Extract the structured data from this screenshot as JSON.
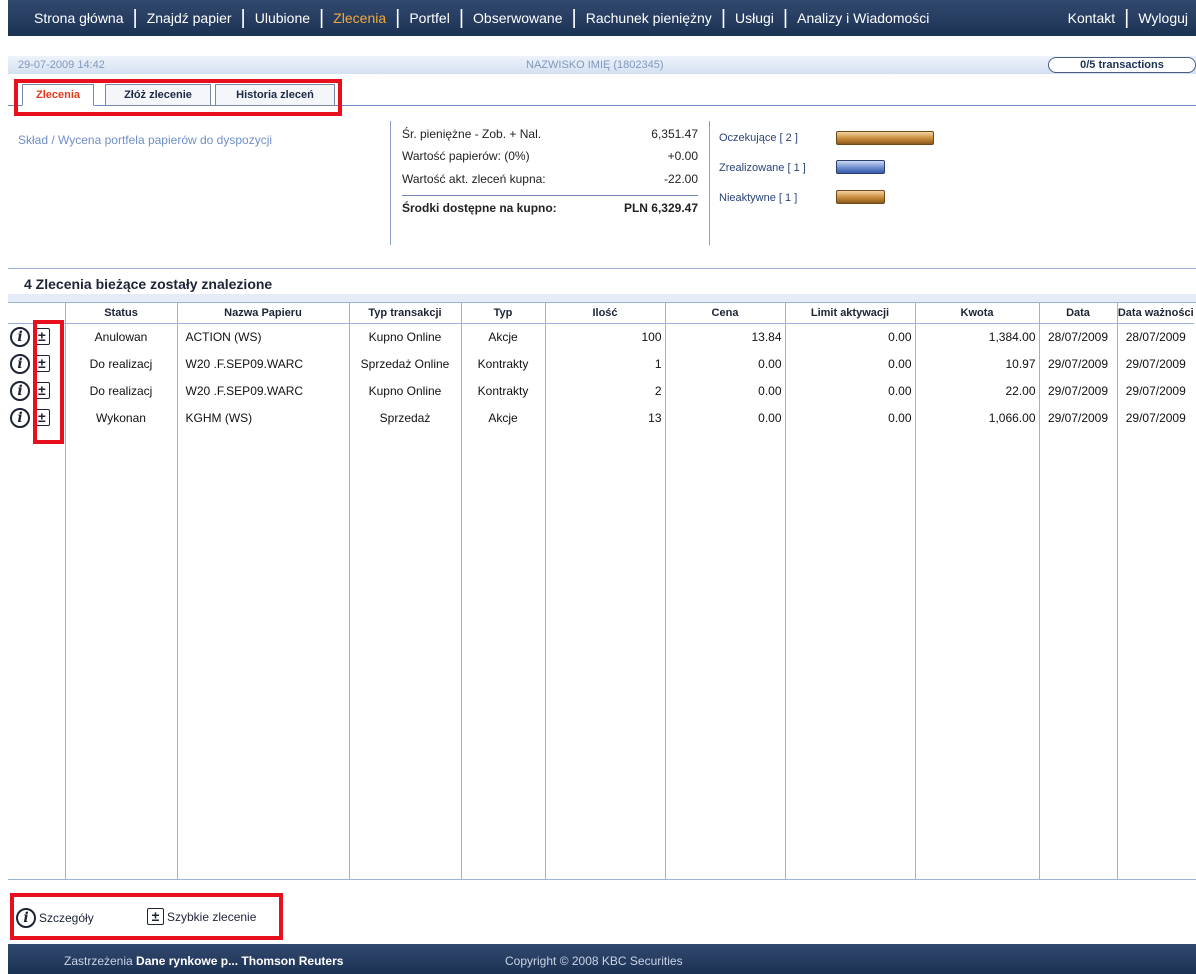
{
  "nav": {
    "items": [
      "Strona główna",
      "Znajdź papier",
      "Ulubione",
      "Zlecenia",
      "Portfel",
      "Obserwowane",
      "Rachunek pieniężny",
      "Usługi",
      "Analizy i Wiadomości"
    ],
    "active_index": 3,
    "right_items": [
      "Kontakt",
      "Wyloguj"
    ]
  },
  "infobar": {
    "datetime": "29-07-2009 14:42",
    "user": "NAZWISKO IMIĘ (1802345)",
    "transactions": "0/5 transactions"
  },
  "tabs": [
    {
      "label": "Zlecenia",
      "active": true
    },
    {
      "label": "Złóż zlecenie",
      "active": false
    },
    {
      "label": "Historia zleceń",
      "active": false
    }
  ],
  "summary": {
    "title": "Skład / Wycena portfela papierów do dyspozycji",
    "rows": [
      {
        "label": "Śr. pieniężne - Zob. + Nal.",
        "value": "6,351.47"
      },
      {
        "label": "Wartość papierów: (0%)",
        "value": "+0.00"
      },
      {
        "label": "Wartość akt. zleceń kupna:",
        "value": "-22.00"
      }
    ],
    "total": {
      "label": "Środki dostępne na kupno:",
      "value": "PLN 6,329.47"
    }
  },
  "legend": [
    {
      "label": "Oczekujące [ 2 ]",
      "color": "orange",
      "count": 2
    },
    {
      "label": "Zrealizowane [ 1 ]",
      "color": "blue",
      "count": 1
    },
    {
      "label": "Nieaktywne [ 1 ]",
      "color": "orange",
      "count": 1
    }
  ],
  "orders": {
    "heading": "4 Zlecenia bieżące zostały znalezione",
    "columns": [
      "Status",
      "Nazwa Papieru",
      "Typ transakcji",
      "Typ",
      "Ilość",
      "Cena",
      "Limit aktywacji",
      "Kwota",
      "Data",
      "Data ważności"
    ],
    "rows": [
      {
        "status": "Anulowan",
        "name": "ACTION (WS)",
        "txtype": "Kupno Online",
        "type": "Akcje",
        "qty": "100",
        "price": "13.84",
        "limit": "0.00",
        "amount": "1,384.00",
        "date": "28/07/2009",
        "expiry": "28/07/2009"
      },
      {
        "status": "Do realizacj",
        "name": "W20 .F.SEP09.WARC",
        "txtype": "Sprzedaż Online",
        "type": "Kontrakty",
        "qty": "1",
        "price": "0.00",
        "limit": "0.00",
        "amount": "10.97",
        "date": "29/07/2009",
        "expiry": "29/07/2009"
      },
      {
        "status": "Do realizacj",
        "name": "W20 .F.SEP09.WARC",
        "txtype": "Kupno Online",
        "type": "Kontrakty",
        "qty": "2",
        "price": "0.00",
        "limit": "0.00",
        "amount": "22.00",
        "date": "29/07/2009",
        "expiry": "29/07/2009"
      },
      {
        "status": "Wykonan",
        "name": "KGHM (WS)",
        "txtype": "Sprzedaż",
        "type": "Akcje",
        "qty": "13",
        "price": "0.00",
        "limit": "0.00",
        "amount": "1,066.00",
        "date": "29/07/2009",
        "expiry": "29/07/2009"
      }
    ]
  },
  "footer_legend": {
    "details": "Szczegóły",
    "quick": "Szybkie zlecenie"
  },
  "bottom": {
    "disclaimer": "Zastrzeżenia",
    "market_data": "Dane rynkowe p... Thomson Reuters",
    "copyright": "Copyright © 2008 KBC Securities"
  },
  "icons": {
    "info": "i",
    "plusminus": "±"
  }
}
